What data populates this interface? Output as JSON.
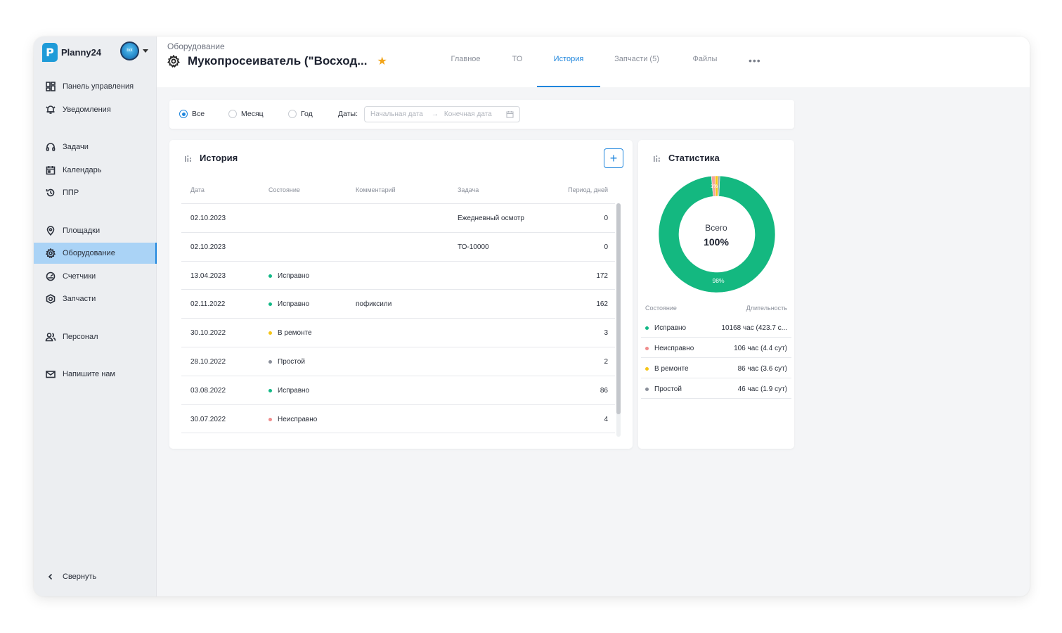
{
  "app": {
    "name": "Planny24",
    "logo_letter": "P",
    "avatar_text": "bot"
  },
  "sidebar": {
    "items": [
      {
        "label": "Панель управления",
        "icon": "dashboard-icon"
      },
      {
        "label": "Уведомления",
        "icon": "bell-icon"
      },
      {
        "label": "Задачи",
        "icon": "headset-icon"
      },
      {
        "label": "Календарь",
        "icon": "calendar-icon"
      },
      {
        "label": "ППР",
        "icon": "history-icon"
      },
      {
        "label": "Площадки",
        "icon": "location-pin-icon"
      },
      {
        "label": "Оборудование",
        "icon": "gear-icon",
        "active": true
      },
      {
        "label": "Счетчики",
        "icon": "gauge-icon"
      },
      {
        "label": "Запчасти",
        "icon": "parts-icon"
      },
      {
        "label": "Персонал",
        "icon": "people-icon"
      },
      {
        "label": "Напишите нам",
        "icon": "mail-icon"
      }
    ],
    "collapse_label": "Свернуть"
  },
  "header": {
    "breadcrumb": "Оборудование",
    "title": "Мукопросеиватель (\"Восход...",
    "tabs": [
      {
        "label": "Главное"
      },
      {
        "label": "ТО"
      },
      {
        "label": "История",
        "active": true
      },
      {
        "label": "Запчасти (5)"
      },
      {
        "label": "Файлы"
      }
    ],
    "more_label": "•••"
  },
  "filter": {
    "options": [
      "Все",
      "Месяц",
      "Год"
    ],
    "selected": "Все",
    "dates_label": "Даты:",
    "start_placeholder": "Начальная дата",
    "end_placeholder": "Конечная дата"
  },
  "history": {
    "title": "История",
    "add_label": "+",
    "columns": [
      "Дата",
      "Состояние",
      "Комментарий",
      "Задача",
      "Период, дней"
    ],
    "rows": [
      {
        "date": "02.10.2023",
        "status": "",
        "status_color": "",
        "comment": "",
        "task": "Ежедневный осмотр",
        "period": "0"
      },
      {
        "date": "02.10.2023",
        "status": "",
        "status_color": "",
        "comment": "",
        "task": "ТО-10000",
        "period": "0"
      },
      {
        "date": "13.04.2023",
        "status": "Исправно",
        "status_color": "#12b886",
        "comment": "",
        "task": "",
        "period": "172"
      },
      {
        "date": "02.11.2022",
        "status": "Исправно",
        "status_color": "#12b886",
        "comment": "пофиксили",
        "task": "",
        "period": "162"
      },
      {
        "date": "30.10.2022",
        "status": "В ремонте",
        "status_color": "#f5c518",
        "comment": "",
        "task": "",
        "period": "3"
      },
      {
        "date": "28.10.2022",
        "status": "Простой",
        "status_color": "#8a8f9a",
        "comment": "",
        "task": "",
        "period": "2"
      },
      {
        "date": "03.08.2022",
        "status": "Исправно",
        "status_color": "#12b886",
        "comment": "",
        "task": "",
        "period": "86"
      },
      {
        "date": "30.07.2022",
        "status": "Неисправно",
        "status_color": "#f08c8c",
        "comment": "",
        "task": "",
        "period": "4"
      }
    ]
  },
  "stats": {
    "title": "Статистика",
    "total_label": "Всего",
    "total_value": "100%",
    "main_pct_label": "98%",
    "small_pct_label": "1%",
    "segments": [
      {
        "label": "Исправно",
        "fraction": 0.975,
        "color": "#14b880"
      },
      {
        "label": "Неисправно",
        "fraction": 0.01,
        "color": "#f3a59c"
      },
      {
        "label": "В ремонте",
        "fraction": 0.0085,
        "color": "#f5c518"
      },
      {
        "label": "Простой",
        "fraction": 0.0045,
        "color": "#9ea3ab"
      }
    ],
    "columns": [
      "Состояние",
      "Длительность"
    ],
    "rows": [
      {
        "label": "Исправно",
        "value": "10168 час (423.7 с...",
        "color": "#12b886"
      },
      {
        "label": "Неисправно",
        "value": "106 час (4.4 сут)",
        "color": "#f08c8c"
      },
      {
        "label": "В ремонте",
        "value": "86 час (3.6 сут)",
        "color": "#f5c518"
      },
      {
        "label": "Простой",
        "value": "46 час (1.9 сут)",
        "color": "#8a8f9a"
      }
    ]
  }
}
